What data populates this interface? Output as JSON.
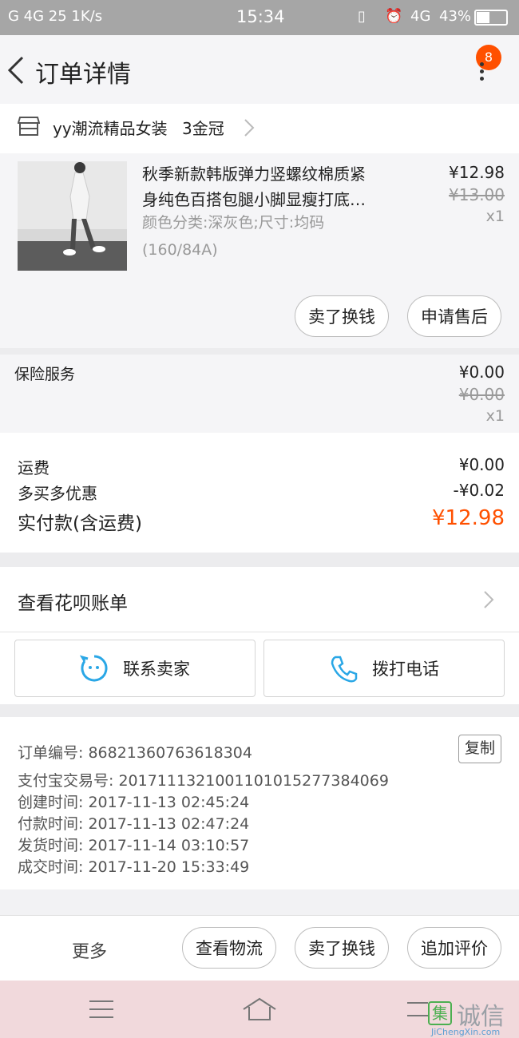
{
  "status": {
    "left": "G 4G 25 1K/s",
    "time": "15:34",
    "network": "4G",
    "battery": "43%"
  },
  "header": {
    "title": "订单详情",
    "badge": "8"
  },
  "shop": {
    "name": "yy潮流精品女装",
    "level": "3金冠"
  },
  "product": {
    "title_line1": "秋季新款韩版弹力竖螺纹棉质紧",
    "title_line2": "身纯色百搭包腿小脚显瘦打底…",
    "spec_line1": "颜色分类:深灰色;尺寸:均码",
    "spec_line2": "(160/84A)",
    "price": "¥12.98",
    "original_price": "¥13.00",
    "qty": "x1",
    "btn_resell": "卖了换钱",
    "btn_aftersale": "申请售后"
  },
  "insurance": {
    "label": "保险服务",
    "price": "¥0.00",
    "original_price": "¥0.00",
    "qty": "x1"
  },
  "summary": {
    "shipping_label": "运费",
    "shipping_value": "¥0.00",
    "discount_label": "多买多优惠",
    "discount_value": "-¥0.02",
    "paid_label": "实付款(含运费)",
    "paid_value": "¥12.98"
  },
  "huabei": {
    "label": "查看花呗账单"
  },
  "contact": {
    "seller": "联系卖家",
    "phone": "拨打电话"
  },
  "order_info": {
    "order_no_label": "订单编号:",
    "order_no": "86821360763618304",
    "copy": "复制",
    "alipay_label": "支付宝交易号:",
    "alipay_no": "2017111321001101015277384069",
    "created_label": "创建时间:",
    "created": "2017-11-13  02:45:24",
    "paid_label": "付款时间:",
    "paid": "2017-11-13  02:47:24",
    "shipped_label": "发货时间:",
    "shipped": "2017-11-14  03:10:57",
    "done_label": "成交时间:",
    "done": "2017-11-20  15:33:49"
  },
  "bottom": {
    "more": "更多",
    "logistics": "查看物流",
    "resell": "卖了换钱",
    "review": "追加评价"
  },
  "watermark": {
    "text": "诚信",
    "sub": "JiChengXin.com"
  },
  "colors": {
    "accent": "#ff5000",
    "badge": "#ff5000",
    "icon_blue": "#2aa7e6",
    "status_bar": "#a6a6a6"
  }
}
